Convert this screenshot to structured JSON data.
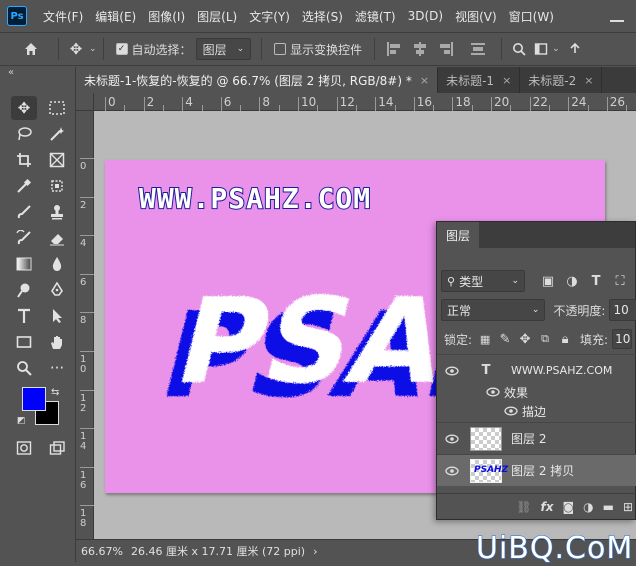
{
  "app": {
    "logo": "Ps"
  },
  "menu": [
    "文件(F)",
    "编辑(E)",
    "图像(I)",
    "图层(L)",
    "文字(Y)",
    "选择(S)",
    "滤镜(T)",
    "3D(D)",
    "视图(V)",
    "窗口(W)"
  ],
  "options": {
    "auto_select_label": "自动选择：",
    "auto_select_checked": true,
    "auto_select_value": "图层",
    "show_transform_label": "显示变换控件",
    "show_transform_checked": false
  },
  "tabs": [
    {
      "label": "未标题-1-恢复的-恢复的 @ 66.7% (图层 2 拷贝, RGB/8#) *",
      "active": true,
      "close": "×"
    },
    {
      "label": "未标题-1",
      "active": false,
      "close": "×"
    },
    {
      "label": "未标题-2",
      "active": false,
      "close": "×"
    }
  ],
  "ruler": {
    "top_ticks": [
      "0",
      "2",
      "4",
      "6",
      "8",
      "10",
      "12",
      "14",
      "16",
      "18",
      "20",
      "22",
      "24",
      "26"
    ],
    "left_ticks": [
      "0",
      "2",
      "4",
      "6",
      "8",
      "1\n0",
      "1\n2",
      "1\n4",
      "1\n6",
      "1\n8"
    ]
  },
  "canvas": {
    "background": "#ea92ea",
    "url_text": "WWW.PSAHZ.COM",
    "big_text": "PSAHZ",
    "big_text_fill": "#ffffff",
    "big_text_shadow": "#0a0ae6"
  },
  "colors": {
    "foreground": "#0000ff",
    "background": "#000000"
  },
  "status": {
    "zoom": "66.67%",
    "doc_size": "26.46 厘米 x 17.71 厘米 (72 ppi)",
    "arrow": "›"
  },
  "layers_panel": {
    "tab": "图层",
    "filter_kind": "类型",
    "blend_mode": "正常",
    "opacity_label": "不透明度:",
    "opacity_value": "10",
    "lock_label": "锁定:",
    "fill_label": "填充:",
    "fill_value": "10",
    "layers": [
      {
        "name": "WWW.PSAHZ.COM",
        "kind": "text",
        "visible": true
      },
      {
        "name": "效果",
        "kind": "effects",
        "visible": true
      },
      {
        "name": "描边",
        "kind": "effect",
        "visible": true
      },
      {
        "name": "图层 2",
        "kind": "pixel",
        "visible": true
      },
      {
        "name": "图层 2 拷贝",
        "kind": "pixel",
        "visible": true,
        "selected": true
      }
    ],
    "footer_fx": "fx"
  },
  "watermark": "UiBQ.CoM"
}
